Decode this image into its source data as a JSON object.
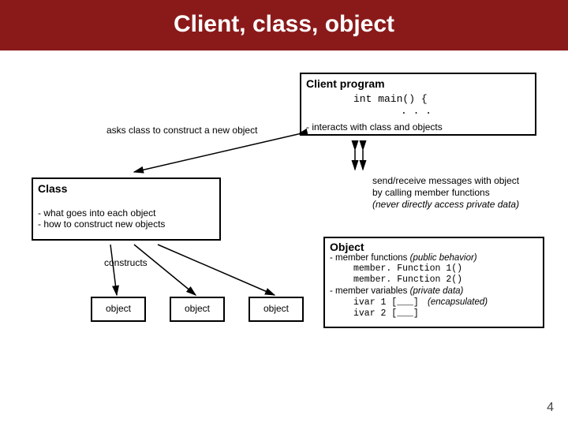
{
  "title": "Client, class, object",
  "client": {
    "heading": "Client program",
    "code1": "int main() {",
    "code2": ". . .",
    "asks": "asks class to construct a new object",
    "interacts": "- interacts with class and objects",
    "msg1": "send/receive messages with object",
    "msg2": "by calling member functions",
    "msg3": "(never directly access private data)"
  },
  "class": {
    "heading": "Class",
    "line1": "- what goes into each object",
    "line2": "- how to construct new objects",
    "constructs": "constructs"
  },
  "objects": {
    "o1": "object",
    "o2": "object",
    "o3": "object"
  },
  "object_desc": {
    "heading": "Object",
    "mf": "- member functions ",
    "mf_note": "(public behavior)",
    "mf1": "member. Function 1()",
    "mf2": "member. Function 2()",
    "mv": "- member variables ",
    "mv_note": "(private data)",
    "iv1": "ivar 1 [___]",
    "iv2": "ivar 2 [___]",
    "enc": "(encapsulated)"
  },
  "pagenum": "4"
}
